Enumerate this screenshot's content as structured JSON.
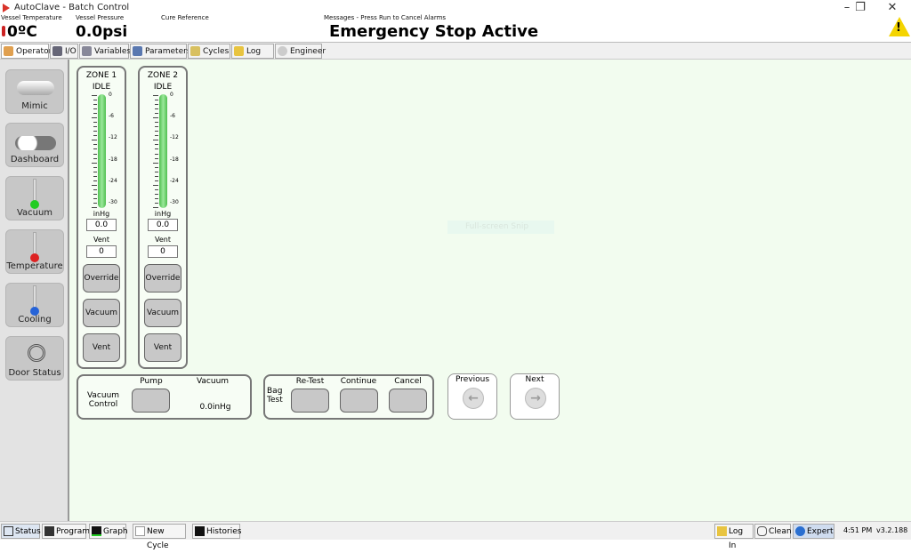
{
  "window": {
    "title": "AutoClave - Batch Control",
    "minimize": "–",
    "restore": "❐",
    "close": "✕"
  },
  "header": {
    "vessel_temperature_label": "Vessel Temperature",
    "vessel_temperature": "0ºC",
    "vessel_pressure_label": "Vessel Pressure",
    "vessel_pressure": "0.0psi",
    "cure_reference_label": "Cure Reference",
    "messages_label": "Messages - Press Run to Cancel Alarms",
    "message": "Emergency Stop Active",
    "warning_icon": "warning-icon",
    "warning_glyph": "!"
  },
  "tabs": [
    {
      "label": "Operator",
      "active": true
    },
    {
      "label": "I/O"
    },
    {
      "label": "Variables"
    },
    {
      "label": "Parameters"
    },
    {
      "label": "Cycles"
    },
    {
      "label": "Log Ins"
    },
    {
      "label": "Engineer"
    }
  ],
  "sidebar": [
    {
      "label": "Mimic"
    },
    {
      "label": "Dashboard"
    },
    {
      "label": "Vacuum"
    },
    {
      "label": "Temperature"
    },
    {
      "label": "Cooling"
    },
    {
      "label": "Door Status"
    }
  ],
  "zones": [
    {
      "title": "ZONE 1",
      "state": "IDLE",
      "ticks": [
        "0",
        "-6",
        "-12",
        "-18",
        "-24",
        "-30"
      ],
      "unit": "inHg",
      "value": "0.0",
      "vent_label": "Vent",
      "vent": "0",
      "buttons": [
        "Override",
        "Vacuum",
        "Vent"
      ]
    },
    {
      "title": "ZONE 2",
      "state": "IDLE",
      "ticks": [
        "0",
        "-6",
        "-12",
        "-18",
        "-24",
        "-30"
      ],
      "unit": "inHg",
      "value": "0.0",
      "vent_label": "Vent",
      "vent": "0",
      "buttons": [
        "Override",
        "Vacuum",
        "Vent"
      ]
    }
  ],
  "vacuum_control": {
    "label_line1": "Vacuum",
    "label_line2": "Control",
    "pump_label": "Pump",
    "vacuum_label": "Vacuum",
    "vacuum_value": "0.0inHg"
  },
  "bag_test": {
    "label_line1": "Bag",
    "label_line2": "Test",
    "retest": "Re-Test",
    "continue": "Continue",
    "cancel": "Cancel"
  },
  "nav": {
    "previous": "Previous",
    "next": "Next",
    "prev_glyph": "←",
    "next_glyph": "→"
  },
  "overlay": {
    "snip": "Full-screen Snip"
  },
  "statusbar": {
    "left": [
      "Status",
      "Program",
      "Graph",
      "New Cycle",
      "Histories"
    ],
    "right": [
      "Log In",
      "Clean",
      "Expert"
    ],
    "time": "4:51 PM",
    "version": "v3.2.188"
  }
}
